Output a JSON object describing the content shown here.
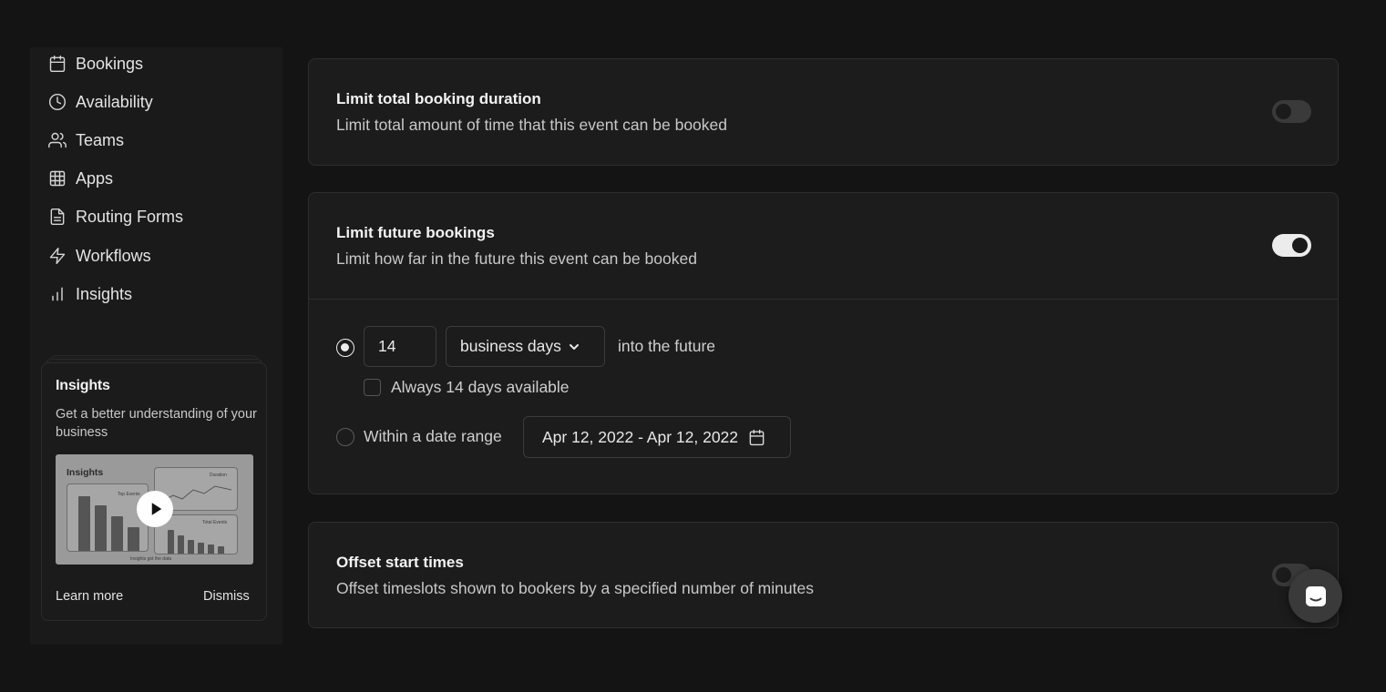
{
  "sidebar": {
    "items": [
      {
        "label": "Bookings",
        "icon": "calendar-icon"
      },
      {
        "label": "Availability",
        "icon": "clock-icon"
      },
      {
        "label": "Teams",
        "icon": "users-icon"
      },
      {
        "label": "Apps",
        "icon": "grid-icon"
      },
      {
        "label": "Routing Forms",
        "icon": "file-text-icon"
      },
      {
        "label": "Workflows",
        "icon": "zap-icon"
      },
      {
        "label": "Insights",
        "icon": "bar-chart-icon"
      }
    ],
    "promo": {
      "title": "Insights",
      "description": "Get a better understanding of your business",
      "thumbnail": {
        "label": "Insights",
        "panel_top_right": "Duration",
        "panel_bottom_left": "Top Events",
        "panel_bottom_right": "Total Events",
        "caption": "Insights got the data"
      },
      "learn_more": "Learn more",
      "dismiss": "Dismiss"
    }
  },
  "cards": {
    "duration": {
      "title": "Limit total booking duration",
      "description": "Limit total amount of time that this event can be booked",
      "enabled": false
    },
    "future": {
      "title": "Limit future bookings",
      "description": "Limit how far in the future this event can be booked",
      "enabled": true,
      "days_value": "14",
      "days_unit": "business days",
      "into_future": "into the future",
      "always_available": "Always 14 days available",
      "date_range_label": "Within a date range",
      "date_range_value": "Apr 12, 2022 - Apr 12, 2022"
    },
    "offset": {
      "title": "Offset start times",
      "description": "Offset timeslots shown to bookers by a specified number of minutes",
      "enabled": false
    }
  },
  "colors": {
    "background": "#141414",
    "card": "#1c1c1c",
    "toggle_on": "#ececec"
  }
}
